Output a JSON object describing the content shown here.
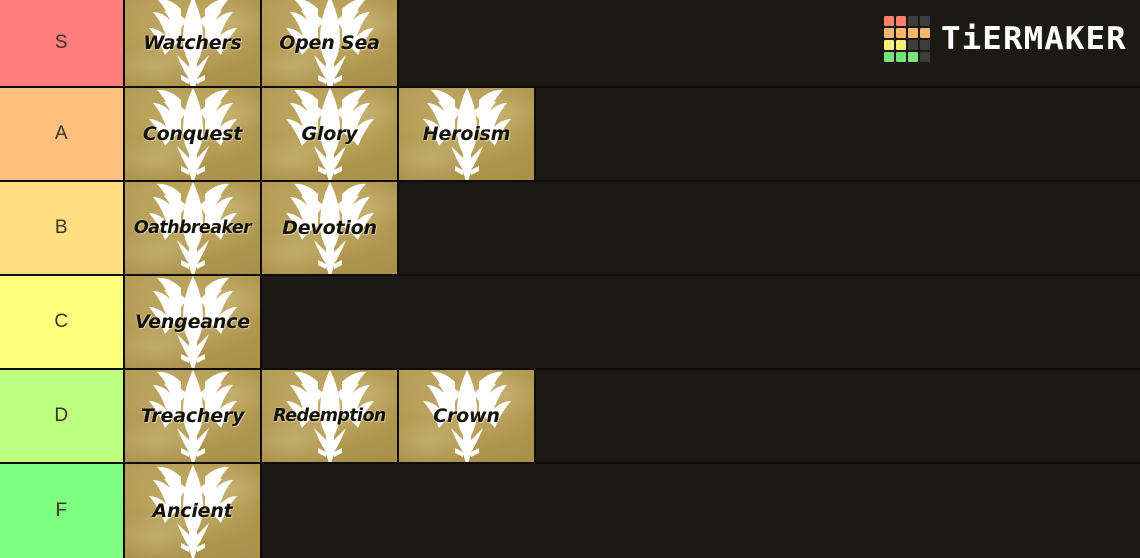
{
  "app": {
    "name": "TierMaker",
    "logo_word": "TiERMAKER",
    "background_color": "#1b1914",
    "border_color": "#0d0c0a"
  },
  "brand": {
    "logo_grid_colors": [
      "#fa8072",
      "#fa8072",
      "#3d3d3d",
      "#3d3d3d",
      "#f9b56e",
      "#f9b56e",
      "#f9b56e",
      "#f9b56e",
      "#f7ed7a",
      "#f7ed7a",
      "#3d3d3d",
      "#3d3d3d",
      "#79e37b",
      "#79e37b",
      "#79e37b",
      "#3d3d3d"
    ]
  },
  "tiers": [
    {
      "label": "S",
      "color": "#ff7f7f",
      "items": [
        {
          "name": "Watchers"
        },
        {
          "name": "Open Sea"
        }
      ]
    },
    {
      "label": "A",
      "color": "#ffbf7f",
      "items": [
        {
          "name": "Conquest"
        },
        {
          "name": "Glory"
        },
        {
          "name": "Heroism"
        }
      ]
    },
    {
      "label": "B",
      "color": "#ffdf7f",
      "items": [
        {
          "name": "Oathbreaker"
        },
        {
          "name": "Devotion"
        }
      ]
    },
    {
      "label": "C",
      "color": "#ffff7f",
      "items": [
        {
          "name": "Vengeance"
        }
      ]
    },
    {
      "label": "D",
      "color": "#bfff7f",
      "items": [
        {
          "name": "Treachery"
        },
        {
          "name": "Redemption"
        },
        {
          "name": "Crown"
        }
      ]
    },
    {
      "label": "F",
      "color": "#7fff7f",
      "items": [
        {
          "name": "Ancient"
        }
      ]
    }
  ],
  "item_tile": {
    "icon": "winged-crest-icon",
    "background_color": "#b79f56"
  }
}
